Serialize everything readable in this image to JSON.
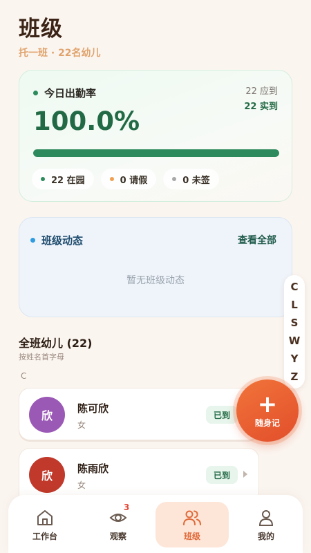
{
  "header": {
    "title": "班级",
    "subtitle": "托一班 · 22名幼儿"
  },
  "attendance": {
    "title": "今日出勤率",
    "rate": "100.0%",
    "progress": 1.0,
    "expected": "22 应到",
    "actual": "22 实到",
    "stats": [
      {
        "label": "22 在园",
        "color": "#2d8a5c"
      },
      {
        "label": "0 请假",
        "color": "#f0a050"
      },
      {
        "label": "0 未签",
        "color": "#a8a8a8"
      }
    ]
  },
  "activity": {
    "title": "班级动态",
    "view_all": "查看全部",
    "empty": "暂无班级动态"
  },
  "roster": {
    "title": "全班幼儿 (22)",
    "subtitle": "按姓名首字母",
    "section_letter": "C",
    "children": [
      {
        "avatar": "欣",
        "avatar_color": "#9b59b6",
        "name": "陈可欣",
        "gender": "女",
        "status": "已到"
      },
      {
        "avatar": "欣",
        "avatar_color": "#c0392b",
        "name": "陈雨欣",
        "gender": "女",
        "status": "已到"
      }
    ]
  },
  "alpha_index": [
    "C",
    "L",
    "S",
    "W",
    "Y",
    "Z"
  ],
  "fab": {
    "plus": "+",
    "label": "随身记"
  },
  "nav": {
    "items": [
      {
        "label": "工作台",
        "icon": "home-icon"
      },
      {
        "label": "观察",
        "icon": "eye-icon",
        "badge": "3"
      },
      {
        "label": "班级",
        "icon": "users-icon",
        "active": true
      },
      {
        "label": "我的",
        "icon": "user-icon"
      }
    ]
  },
  "colors": {
    "accent": "#e06a3a",
    "attendance_green": "#226a45",
    "activity_dot": "#2f9be0",
    "background": "#fbf5f0"
  }
}
